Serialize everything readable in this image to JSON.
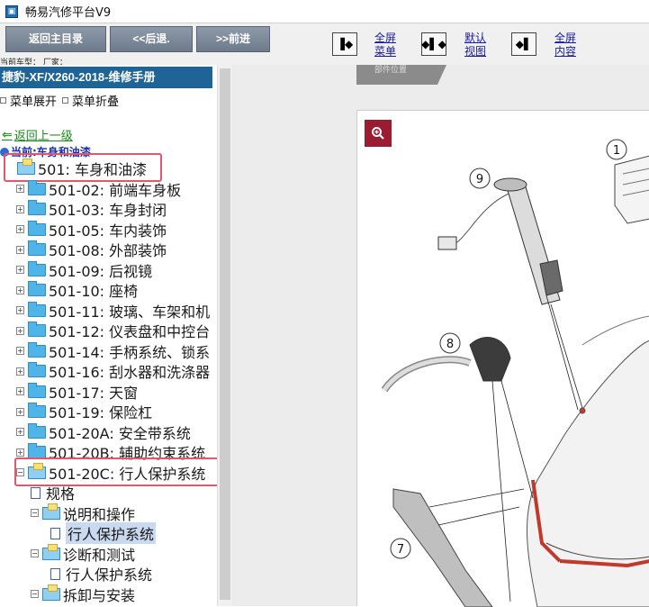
{
  "window": {
    "title": "畅易汽修平台V9",
    "icon": "app-icon"
  },
  "toolbar": {
    "back_main": "返回主目录",
    "back": "<<后退.",
    "forward": ">>前进",
    "fullscreen_menu": [
      "全屏",
      "菜单"
    ],
    "default_view": [
      "默认",
      "视图"
    ],
    "fullscreen_content": [
      "全屏",
      "内容"
    ],
    "model_line": "当前车型：   厂家："
  },
  "sidebar": {
    "header": "捷豹-XF/X260-2018-维修手册",
    "expand_all": "菜单展开",
    "collapse_all": "菜单折叠",
    "back_up": "返回上一级",
    "current": "当前:车身和油漆",
    "tree": [
      {
        "label": "501: 车身和油漆",
        "type": "open",
        "indent": 0,
        "highlight": true
      },
      {
        "label": "501-02: 前端车身板",
        "type": "folder",
        "indent": 1
      },
      {
        "label": "501-03: 车身封闭",
        "type": "folder",
        "indent": 1
      },
      {
        "label": "501-05: 车内装饰",
        "type": "folder",
        "indent": 1
      },
      {
        "label": "501-08: 外部装饰",
        "type": "folder",
        "indent": 1
      },
      {
        "label": "501-09: 后视镜",
        "type": "folder",
        "indent": 1
      },
      {
        "label": "501-10: 座椅",
        "type": "folder",
        "indent": 1
      },
      {
        "label": "501-11: 玻璃、车架和机",
        "type": "folder",
        "indent": 1
      },
      {
        "label": "501-12: 仪表盘和中控台",
        "type": "folder",
        "indent": 1
      },
      {
        "label": "501-14: 手柄系统、锁系",
        "type": "folder",
        "indent": 1
      },
      {
        "label": "501-16: 刮水器和洗涤器",
        "type": "folder",
        "indent": 1
      },
      {
        "label": "501-17: 天窗",
        "type": "folder",
        "indent": 1
      },
      {
        "label": "501-19: 保险杠",
        "type": "folder",
        "indent": 1
      },
      {
        "label": "501-20A: 安全带系统",
        "type": "folder",
        "indent": 1
      },
      {
        "label": "501-20B: 辅助约束系统",
        "type": "folder",
        "indent": 1
      },
      {
        "label": "501-20C: 行人保护系统",
        "type": "open",
        "indent": 1,
        "highlight": true
      },
      {
        "label": "规格",
        "type": "doc",
        "indent": 2
      },
      {
        "label": "说明和操作",
        "type": "open",
        "indent": 2
      },
      {
        "label": "行人保护系统",
        "type": "doc",
        "indent": 3,
        "selected": true
      },
      {
        "label": "诊断和测试",
        "type": "open",
        "indent": 2
      },
      {
        "label": "行人保护系统",
        "type": "doc",
        "indent": 3
      },
      {
        "label": "拆卸与安装",
        "type": "open",
        "indent": 2
      }
    ]
  },
  "content": {
    "tab_label": "部件位置",
    "zoom_icon": "zoom-in-icon",
    "callouts": [
      "1",
      "9",
      "8",
      "7"
    ]
  },
  "colors": {
    "header_bg": "#1e6496",
    "highlight": "#e4566a",
    "zoom_bg": "#9b1b30",
    "nav_btn": "#7a8898"
  }
}
